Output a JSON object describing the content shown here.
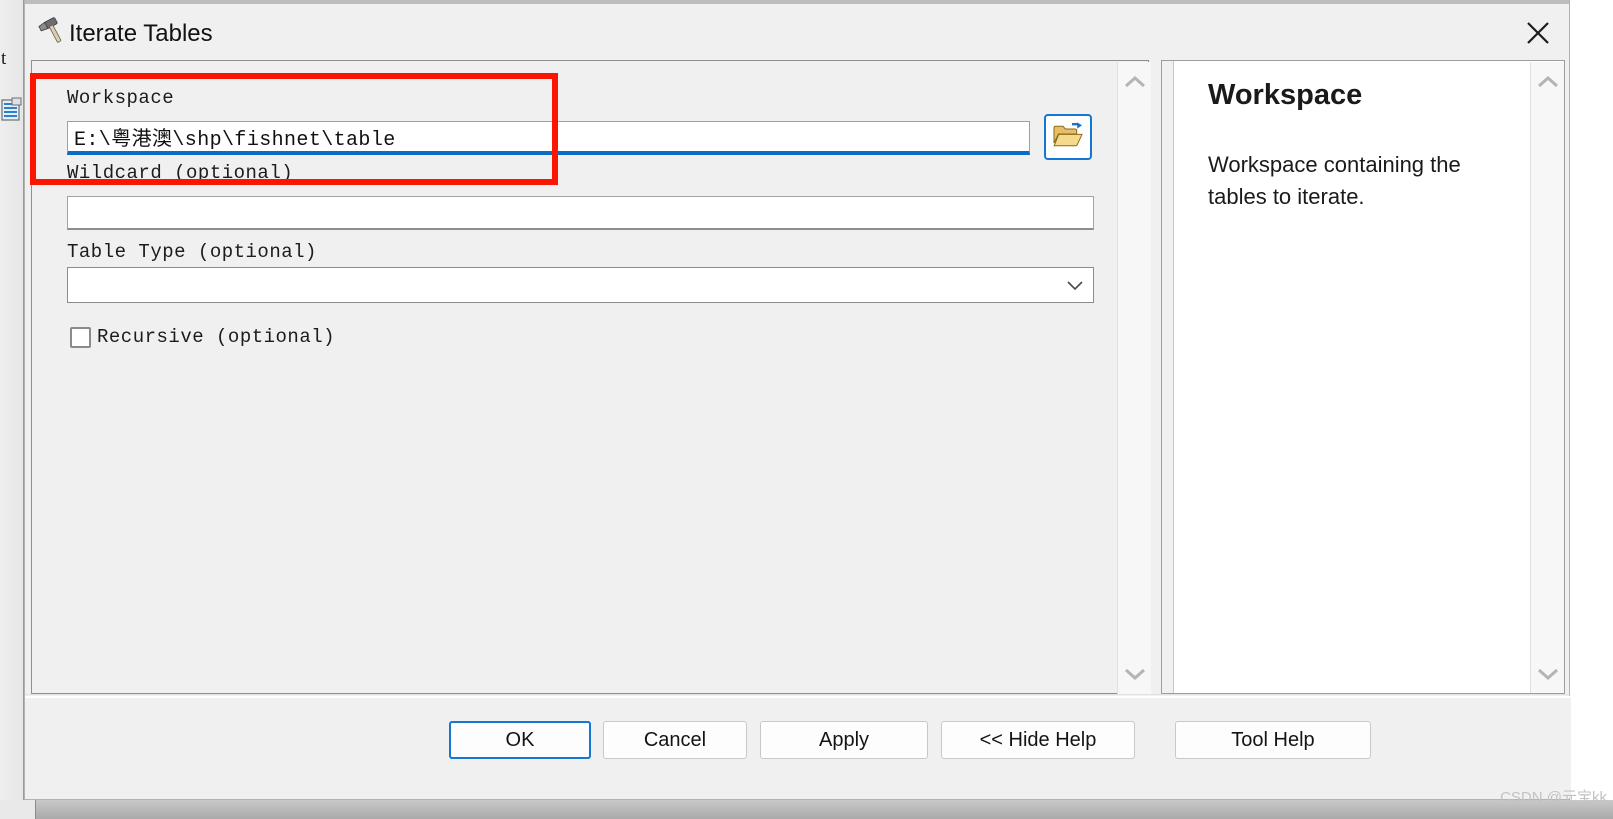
{
  "window": {
    "title": "Iterate Tables",
    "title_icon": "hammer-icon",
    "close_icon": "close-icon"
  },
  "params": {
    "workspace": {
      "label": "Workspace",
      "value": "E:\\粤港澳\\shp\\fishnet\\table",
      "placeholder": "",
      "browse_icon": "folder-open-arrow-icon"
    },
    "wildcard": {
      "label": "Wildcard (optional)",
      "value": "",
      "placeholder": ""
    },
    "table_type": {
      "label": "Table Type (optional)",
      "value": "",
      "chevron_icon": "chevron-down-icon"
    },
    "recursive": {
      "label": "Recursive (optional)",
      "checked": false
    }
  },
  "scrollbars": {
    "up_icon": "chevron-up-icon",
    "down_icon": "chevron-down-icon"
  },
  "help": {
    "title": "Workspace",
    "text": "Workspace containing the tables to iterate."
  },
  "footer": {
    "ok": "OK",
    "cancel": "Cancel",
    "apply": "Apply",
    "hide_help": "<< Hide Help",
    "tool_help": "Tool Help"
  },
  "annotation": {
    "color": "#fb1603"
  },
  "watermark": {
    "text": "CSDN @元宝kk"
  },
  "background": {
    "letter": "t",
    "table_icon": "table-list-icon"
  },
  "colors": {
    "accent": "#0a6cc4",
    "focus_border": "#1477d3",
    "dialog_bg": "#f0f0f0",
    "help_bg": "#ffffff"
  }
}
